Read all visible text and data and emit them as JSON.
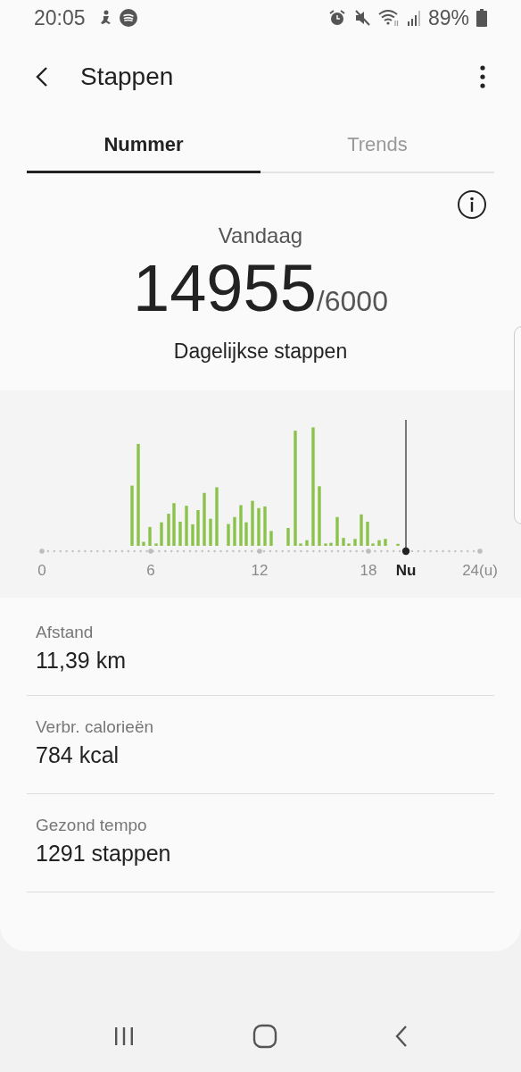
{
  "status_bar": {
    "time": "20:05",
    "battery": "89%"
  },
  "header": {
    "title": "Stappen"
  },
  "tabs": [
    {
      "label": "Nummer",
      "selected": true
    },
    {
      "label": "Trends",
      "selected": false
    }
  ],
  "summary": {
    "period": "Vandaag",
    "steps": "14955",
    "goal": "/6000",
    "caption": "Dagelijkse stappen"
  },
  "chart": {
    "axis_labels": [
      {
        "label": "0",
        "current": false
      },
      {
        "label": "6",
        "current": false
      },
      {
        "label": "12",
        "current": false
      },
      {
        "label": "18",
        "current": false
      },
      {
        "label": "Nu",
        "current": true
      },
      {
        "label": "24(u)",
        "current": false
      }
    ]
  },
  "stats": [
    {
      "label": "Afstand",
      "value": "11,39 km"
    },
    {
      "label": "Verbr. calorieën",
      "value": "784 kcal"
    },
    {
      "label": "Gezond tempo",
      "value": "1291 stappen"
    }
  ]
}
